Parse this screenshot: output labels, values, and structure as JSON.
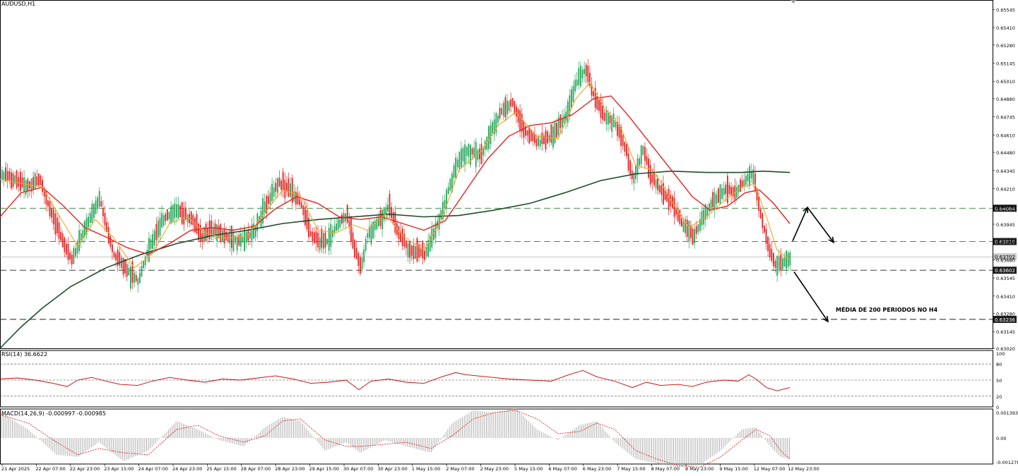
{
  "symbol": "AUDUSD,H1",
  "annotation": "MÉDIA DE 200 PERIODOS NO H4",
  "colors": {
    "bull": "#26a65b",
    "bear": "#e02424",
    "ma_fast": "#f5a623",
    "ma_mid": "#e82020",
    "ma_slow": "#1e4d2b",
    "rsi": "#cc0000",
    "macd_signal": "#e02424",
    "macd_hist": "#b0b0b0",
    "level_line": "#2e7d32",
    "price_tag_bg": "#1a1a1a"
  },
  "chart_data": [
    {
      "type": "candlestick",
      "title": "AUDUSD,H1",
      "y_ticks": [
        "0.65545",
        "0.65410",
        "0.65280",
        "0.65145",
        "0.65010",
        "0.64880",
        "0.64745",
        "0.64610",
        "0.64480",
        "0.64345",
        "0.64210",
        "0.64075",
        "0.63945",
        "0.63810",
        "0.63680",
        "0.63545",
        "0.63410",
        "0.63280",
        "0.63145",
        "0.63020"
      ],
      "x_ticks": [
        "21 Apr 2025",
        "22 Apr 07:00",
        "22 Apr 23:00",
        "23 Apr 15:00",
        "24 Apr 07:00",
        "24 Apr 23:00",
        "25 Apr 15:00",
        "28 Apr 07:00",
        "28 Apr 23:00",
        "29 Apr 15:00",
        "30 Apr 07:00",
        "30 Apr 23:00",
        "1 May 15:00",
        "2 May 07:00",
        "2 May 23:00",
        "5 May 15:00",
        "6 May 07:00",
        "6 May 23:00",
        "7 May 15:00",
        "8 May 07:00",
        "8 May 23:00",
        "9 May 15:00",
        "12 May 07:00",
        "12 May 23:00"
      ],
      "ylim": [
        0.6302,
        0.6561
      ],
      "grid": false,
      "price_path": [
        [
          0,
          0.6432
        ],
        [
          40,
          0.6423
        ],
        [
          55,
          0.6428
        ],
        [
          75,
          0.6398
        ],
        [
          100,
          0.6368
        ],
        [
          120,
          0.6392
        ],
        [
          140,
          0.6414
        ],
        [
          160,
          0.6372
        ],
        [
          180,
          0.636
        ],
        [
          195,
          0.6352
        ],
        [
          210,
          0.6377
        ],
        [
          230,
          0.6398
        ],
        [
          250,
          0.6405
        ],
        [
          270,
          0.6398
        ],
        [
          285,
          0.6385
        ],
        [
          300,
          0.639
        ],
        [
          320,
          0.6385
        ],
        [
          340,
          0.6382
        ],
        [
          360,
          0.639
        ],
        [
          375,
          0.641
        ],
        [
          395,
          0.6425
        ],
        [
          410,
          0.642
        ],
        [
          425,
          0.641
        ],
        [
          440,
          0.6385
        ],
        [
          460,
          0.638
        ],
        [
          475,
          0.6392
        ],
        [
          490,
          0.6402
        ],
        [
          505,
          0.637
        ],
        [
          510,
          0.636
        ],
        [
          520,
          0.6388
        ],
        [
          540,
          0.64
        ],
        [
          550,
          0.6408
        ],
        [
          565,
          0.6385
        ],
        [
          580,
          0.6375
        ],
        [
          600,
          0.6372
        ],
        [
          615,
          0.639
        ],
        [
          630,
          0.6412
        ],
        [
          645,
          0.644
        ],
        [
          660,
          0.645
        ],
        [
          680,
          0.6445
        ],
        [
          695,
          0.6465
        ],
        [
          710,
          0.648
        ],
        [
          725,
          0.6485
        ],
        [
          740,
          0.6465
        ],
        [
          760,
          0.6455
        ],
        [
          780,
          0.646
        ],
        [
          800,
          0.6475
        ],
        [
          815,
          0.65
        ],
        [
          828,
          0.651
        ],
        [
          840,
          0.649
        ],
        [
          855,
          0.6475
        ],
        [
          870,
          0.647
        ],
        [
          885,
          0.645
        ],
        [
          895,
          0.6428
        ],
        [
          910,
          0.645
        ],
        [
          920,
          0.643
        ],
        [
          935,
          0.642
        ],
        [
          950,
          0.641
        ],
        [
          965,
          0.6395
        ],
        [
          980,
          0.6385
        ],
        [
          995,
          0.64
        ],
        [
          1010,
          0.6412
        ],
        [
          1025,
          0.642
        ],
        [
          1040,
          0.6418
        ],
        [
          1055,
          0.6428
        ],
        [
          1065,
          0.6432
        ],
        [
          1075,
          0.6405
        ],
        [
          1085,
          0.638
        ],
        [
          1095,
          0.6365
        ],
        [
          1105,
          0.6365
        ],
        [
          1118,
          0.637
        ]
      ],
      "ma_fast_path": [
        [
          0,
          0.6428
        ],
        [
          40,
          0.6424
        ],
        [
          60,
          0.6422
        ],
        [
          85,
          0.64
        ],
        [
          110,
          0.6378
        ],
        [
          135,
          0.6398
        ],
        [
          160,
          0.6385
        ],
        [
          190,
          0.6362
        ],
        [
          215,
          0.6372
        ],
        [
          240,
          0.6395
        ],
        [
          265,
          0.64
        ],
        [
          290,
          0.6388
        ],
        [
          320,
          0.6384
        ],
        [
          350,
          0.6386
        ],
        [
          375,
          0.6403
        ],
        [
          400,
          0.642
        ],
        [
          425,
          0.6416
        ],
        [
          450,
          0.639
        ],
        [
          475,
          0.6388
        ],
        [
          500,
          0.6394
        ],
        [
          520,
          0.639
        ],
        [
          545,
          0.6402
        ],
        [
          570,
          0.6386
        ],
        [
          600,
          0.6375
        ],
        [
          625,
          0.6398
        ],
        [
          650,
          0.6435
        ],
        [
          680,
          0.6448
        ],
        [
          705,
          0.6468
        ],
        [
          730,
          0.6478
        ],
        [
          760,
          0.646
        ],
        [
          790,
          0.6458
        ],
        [
          815,
          0.6488
        ],
        [
          835,
          0.65
        ],
        [
          855,
          0.6482
        ],
        [
          880,
          0.6465
        ],
        [
          900,
          0.6438
        ],
        [
          925,
          0.6435
        ],
        [
          950,
          0.6412
        ],
        [
          975,
          0.6392
        ],
        [
          1000,
          0.64
        ],
        [
          1025,
          0.6412
        ],
        [
          1050,
          0.6422
        ],
        [
          1068,
          0.6425
        ],
        [
          1085,
          0.64
        ],
        [
          1100,
          0.6375
        ],
        [
          1118,
          0.6368
        ]
      ],
      "ma_mid_path": [
        [
          0,
          0.64
        ],
        [
          30,
          0.6418
        ],
        [
          60,
          0.6422
        ],
        [
          90,
          0.6408
        ],
        [
          120,
          0.6392
        ],
        [
          150,
          0.6385
        ],
        [
          180,
          0.6377
        ],
        [
          210,
          0.6372
        ],
        [
          240,
          0.638
        ],
        [
          270,
          0.639
        ],
        [
          300,
          0.6392
        ],
        [
          330,
          0.639
        ],
        [
          360,
          0.6393
        ],
        [
          390,
          0.6406
        ],
        [
          420,
          0.6415
        ],
        [
          450,
          0.641
        ],
        [
          480,
          0.64
        ],
        [
          510,
          0.6398
        ],
        [
          540,
          0.64
        ],
        [
          570,
          0.6395
        ],
        [
          600,
          0.639
        ],
        [
          630,
          0.6397
        ],
        [
          660,
          0.642
        ],
        [
          690,
          0.6443
        ],
        [
          720,
          0.646
        ],
        [
          750,
          0.6468
        ],
        [
          780,
          0.647
        ],
        [
          810,
          0.6476
        ],
        [
          840,
          0.6488
        ],
        [
          865,
          0.649
        ],
        [
          890,
          0.6475
        ],
        [
          920,
          0.6455
        ],
        [
          950,
          0.6435
        ],
        [
          980,
          0.6415
        ],
        [
          1005,
          0.6405
        ],
        [
          1030,
          0.6408
        ],
        [
          1055,
          0.6418
        ],
        [
          1075,
          0.642
        ],
        [
          1095,
          0.641
        ],
        [
          1118,
          0.6395
        ]
      ],
      "ma_slow_path": [
        [
          0,
          0.6302
        ],
        [
          30,
          0.6318
        ],
        [
          60,
          0.6332
        ],
        [
          100,
          0.6348
        ],
        [
          150,
          0.6362
        ],
        [
          200,
          0.6372
        ],
        [
          250,
          0.638
        ],
        [
          300,
          0.6386
        ],
        [
          350,
          0.639
        ],
        [
          400,
          0.6395
        ],
        [
          450,
          0.6398
        ],
        [
          500,
          0.64
        ],
        [
          550,
          0.6402
        ],
        [
          600,
          0.64
        ],
        [
          650,
          0.6401
        ],
        [
          700,
          0.6405
        ],
        [
          750,
          0.641
        ],
        [
          800,
          0.6418
        ],
        [
          850,
          0.6427
        ],
        [
          900,
          0.6432
        ],
        [
          950,
          0.6434
        ],
        [
          1000,
          0.6433
        ],
        [
          1050,
          0.6433
        ],
        [
          1080,
          0.6434
        ],
        [
          1118,
          0.6433
        ]
      ],
      "levels": [
        {
          "price": 0.64064,
          "label": "0.64064"
        },
        {
          "price": 0.63816,
          "label": "0.63816"
        },
        {
          "price": 0.63602,
          "label": "0.63602"
        },
        {
          "price": 0.63236,
          "label": "0.63236"
        }
      ],
      "current_price": {
        "price": 0.63702,
        "label": "0.63702"
      },
      "arrows": [
        {
          "from": [
            1122,
            0.6382
          ],
          "to": [
            1143,
            0.6407
          ]
        },
        {
          "from": [
            1143,
            0.6407
          ],
          "to": [
            1180,
            0.6381
          ]
        },
        {
          "from": [
            1124,
            0.6359
          ],
          "to": [
            1172,
            0.6322
          ]
        }
      ]
    },
    {
      "type": "line",
      "title": "RSI(14) 36.6622",
      "ylim": [
        0,
        100
      ],
      "levels": [
        80,
        50,
        20
      ],
      "y_ticks": [
        "100",
        "80",
        "50",
        "20",
        "0"
      ],
      "path": [
        [
          0,
          52
        ],
        [
          25,
          54
        ],
        [
          50,
          50
        ],
        [
          75,
          44
        ],
        [
          95,
          38
        ],
        [
          110,
          50
        ],
        [
          130,
          55
        ],
        [
          150,
          48
        ],
        [
          170,
          42
        ],
        [
          195,
          40
        ],
        [
          215,
          48
        ],
        [
          240,
          55
        ],
        [
          265,
          50
        ],
        [
          290,
          46
        ],
        [
          315,
          52
        ],
        [
          340,
          50
        ],
        [
          365,
          54
        ],
        [
          390,
          58
        ],
        [
          415,
          52
        ],
        [
          440,
          44
        ],
        [
          465,
          46
        ],
        [
          490,
          50
        ],
        [
          508,
          32
        ],
        [
          525,
          48
        ],
        [
          550,
          52
        ],
        [
          575,
          46
        ],
        [
          600,
          44
        ],
        [
          625,
          56
        ],
        [
          645,
          64
        ],
        [
          660,
          60
        ],
        [
          690,
          56
        ],
        [
          720,
          52
        ],
        [
          750,
          50
        ],
        [
          780,
          48
        ],
        [
          805,
          60
        ],
        [
          825,
          68
        ],
        [
          845,
          56
        ],
        [
          870,
          48
        ],
        [
          895,
          36
        ],
        [
          915,
          46
        ],
        [
          935,
          40
        ],
        [
          960,
          42
        ],
        [
          980,
          38
        ],
        [
          1000,
          46
        ],
        [
          1025,
          50
        ],
        [
          1045,
          48
        ],
        [
          1060,
          60
        ],
        [
          1070,
          52
        ],
        [
          1085,
          36
        ],
        [
          1100,
          30
        ],
        [
          1118,
          36
        ]
      ]
    },
    {
      "type": "bar",
      "title": "MACD(14,26,9) -0.000997 -0.000985",
      "ylim": [
        -0.001278,
        0.001393
      ],
      "y_ticks": [
        "0.001393",
        "0.00",
        "-0.001278"
      ],
      "hist_path": [
        [
          0,
          0.0012
        ],
        [
          40,
          0.0004
        ],
        [
          80,
          -0.0008
        ],
        [
          110,
          -0.0009
        ],
        [
          140,
          -0.0002
        ],
        [
          175,
          -0.0011
        ],
        [
          210,
          -0.0006
        ],
        [
          250,
          0.0008
        ],
        [
          280,
          0.0004
        ],
        [
          310,
          -0.0001
        ],
        [
          345,
          -0.0004
        ],
        [
          375,
          0.0005
        ],
        [
          400,
          0.001
        ],
        [
          425,
          0.0008
        ],
        [
          460,
          -0.0006
        ],
        [
          490,
          -0.0002
        ],
        [
          510,
          -0.0007
        ],
        [
          545,
          -0.0001
        ],
        [
          575,
          -0.0004
        ],
        [
          610,
          -0.0007
        ],
        [
          640,
          0.0007
        ],
        [
          670,
          0.0013
        ],
        [
          700,
          0.0012
        ],
        [
          730,
          0.0014
        ],
        [
          760,
          0.0004
        ],
        [
          790,
          -0.0001
        ],
        [
          820,
          0.0006
        ],
        [
          845,
          0.0008
        ],
        [
          870,
          -0.0002
        ],
        [
          900,
          -0.001
        ],
        [
          930,
          -0.0012
        ],
        [
          960,
          -0.0014
        ],
        [
          990,
          -0.0013
        ],
        [
          1020,
          -0.0006
        ],
        [
          1050,
          0.0004
        ],
        [
          1070,
          0.0005
        ],
        [
          1090,
          -0.0004
        ],
        [
          1105,
          -0.0009
        ],
        [
          1118,
          -0.001
        ]
      ],
      "signal_path": [
        [
          0,
          0.0011
        ],
        [
          40,
          0.0007
        ],
        [
          80,
          -0.0002
        ],
        [
          110,
          -0.0008
        ],
        [
          140,
          -0.0005
        ],
        [
          175,
          -0.0007
        ],
        [
          210,
          -0.0008
        ],
        [
          250,
          0.0004
        ],
        [
          280,
          0.0006
        ],
        [
          310,
          0.0001
        ],
        [
          345,
          -0.0002
        ],
        [
          375,
          0.0001
        ],
        [
          400,
          0.0008
        ],
        [
          425,
          0.0009
        ],
        [
          460,
          -0.0001
        ],
        [
          490,
          -0.0004
        ],
        [
          510,
          -0.0004
        ],
        [
          545,
          -0.0003
        ],
        [
          575,
          -0.0002
        ],
        [
          610,
          -0.0005
        ],
        [
          640,
          0.0001
        ],
        [
          670,
          0.0009
        ],
        [
          700,
          0.0012
        ],
        [
          730,
          0.0013
        ],
        [
          760,
          0.0009
        ],
        [
          790,
          0.0002
        ],
        [
          820,
          0.0003
        ],
        [
          845,
          0.0007
        ],
        [
          870,
          0.0004
        ],
        [
          900,
          -0.0006
        ],
        [
          930,
          -0.001
        ],
        [
          960,
          -0.0013
        ],
        [
          990,
          -0.0014
        ],
        [
          1020,
          -0.0009
        ],
        [
          1050,
          -0.0001
        ],
        [
          1070,
          0.0004
        ],
        [
          1090,
          0.0001
        ],
        [
          1105,
          -0.0006
        ],
        [
          1118,
          -0.001
        ]
      ]
    }
  ]
}
